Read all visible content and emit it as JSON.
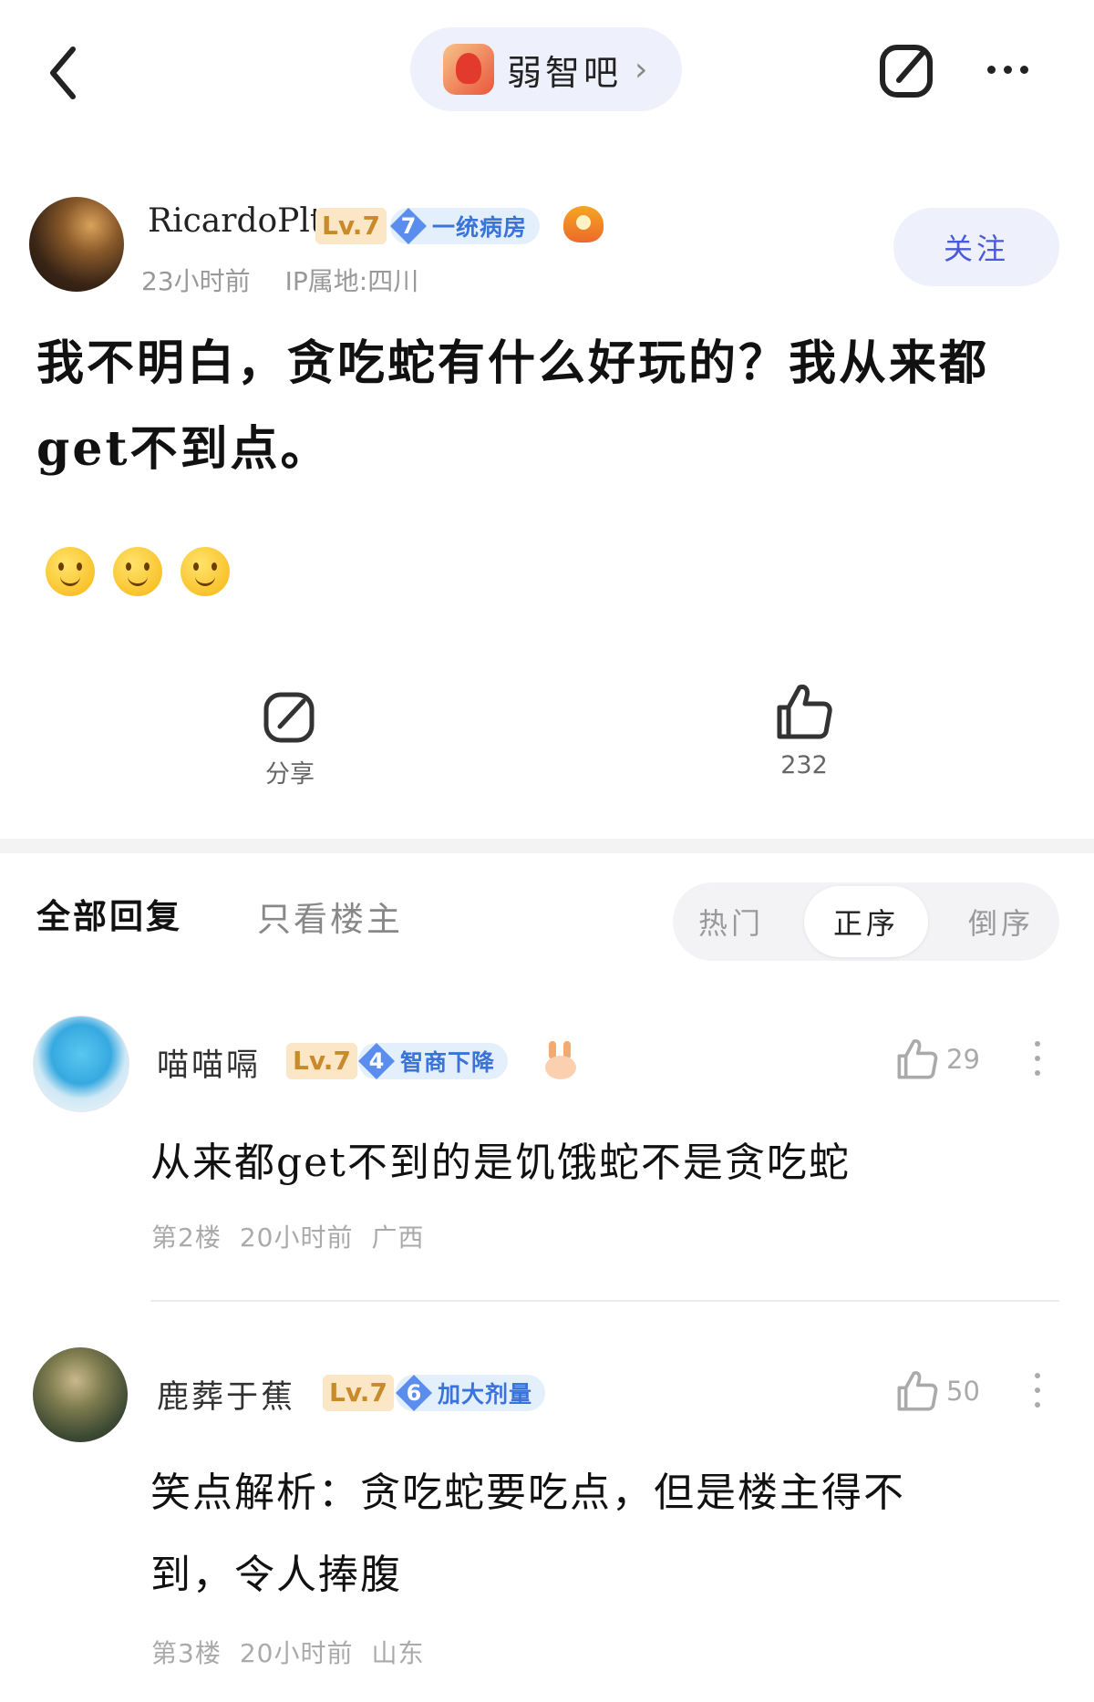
{
  "header": {
    "forum_name": "弱智吧",
    "chevron": "›",
    "icons": {
      "back": "back-chevron-icon",
      "edit": "edit-icon",
      "more": "more-dots-icon",
      "forum": "forum-avatar-icon"
    }
  },
  "post": {
    "author": "RicardoPlt",
    "level": "Lv.7",
    "tag_num": "7",
    "tag_text": "一统病房",
    "time": "23小时前",
    "ip": "IP属地:四川",
    "follow_label": "关注",
    "title": "我不明白，贪吃蛇有什么好玩的？我从来都get不到点。",
    "emojis": [
      "smiley",
      "smiley",
      "smiley"
    ],
    "share_label": "分享",
    "like_count": "232"
  },
  "tabs": {
    "all": "全部回复",
    "op_only": "只看楼主",
    "sort": {
      "hot": "热门",
      "asc": "正序",
      "desc": "倒序",
      "active": "正序"
    }
  },
  "comments": [
    {
      "user": "喵喵嗝",
      "level": "Lv.7",
      "tag_num": "4",
      "tag_text": "智商下降",
      "likes": "29",
      "text": "从来都get不到的是饥饿蛇不是贪吃蛇",
      "floor": "第2楼",
      "time": "20小时前",
      "location": "广西"
    },
    {
      "user": "鹿葬于蕉",
      "level": "Lv.7",
      "tag_num": "6",
      "tag_text": "加大剂量",
      "likes": "50",
      "text_line1": "笑点解析：贪吃蛇要吃点，但是楼主得不",
      "text_line2": "到，令人捧腹",
      "floor": "第3楼",
      "time": "20小时前",
      "location": "山东"
    }
  ],
  "colors": {
    "accent": "#4a59d8",
    "pill_bg": "#eef0fc",
    "level_bg": "#fbe7c5",
    "level_fg": "#c98a2c",
    "tag_bg": "#e4effc",
    "tag_fg": "#3a73d9"
  }
}
